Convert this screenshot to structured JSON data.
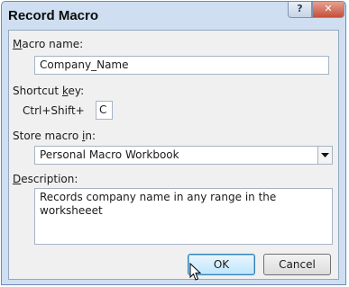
{
  "dialog": {
    "title": "Record Macro",
    "title_buttons": {
      "help": "?",
      "close": "✕"
    }
  },
  "macro_name": {
    "label_mnemonic": "M",
    "label_rest": "acro name:",
    "value": "Company_Name"
  },
  "shortcut_key": {
    "label_before": "Shortcut ",
    "label_mnemonic": "k",
    "label_after": "ey:",
    "prefix": "Ctrl+Shift+",
    "value": "C"
  },
  "store_macro": {
    "label_before": "Store macro ",
    "label_mnemonic": "i",
    "label_after": "n:",
    "selected": "Personal Macro Workbook"
  },
  "description": {
    "label_mnemonic": "D",
    "label_rest": "escription:",
    "value": "Records company name in any range in the worksheeet"
  },
  "buttons": {
    "ok": "OK",
    "cancel": "Cancel"
  },
  "colors": {
    "frame": "#cfdff1",
    "close_button": "#c6503a",
    "ok_button_highlight": "#bee6fd"
  }
}
